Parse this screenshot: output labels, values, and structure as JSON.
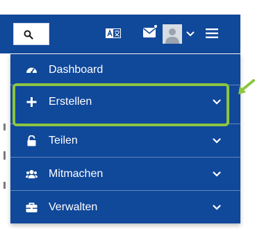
{
  "header": {
    "icons": [
      "search-icon",
      "translate-icon",
      "mail-icon",
      "avatar",
      "chevron-down-icon",
      "menu-icon"
    ]
  },
  "menu": {
    "items": [
      {
        "label": "Dashboard",
        "icon": "dashboard-icon"
      },
      {
        "label": "Erstellen",
        "icon": "plus-icon",
        "expandable": true
      },
      {
        "label": "Teilen",
        "icon": "lock-icon",
        "expandable": true
      },
      {
        "label": "Mitmachen",
        "icon": "users-icon",
        "expandable": true
      },
      {
        "label": "Verwalten",
        "icon": "briefcase-icon",
        "expandable": true
      }
    ]
  },
  "colors": {
    "primary": "#10489a",
    "highlight": "#8cc63f",
    "text": "#ffffff"
  }
}
